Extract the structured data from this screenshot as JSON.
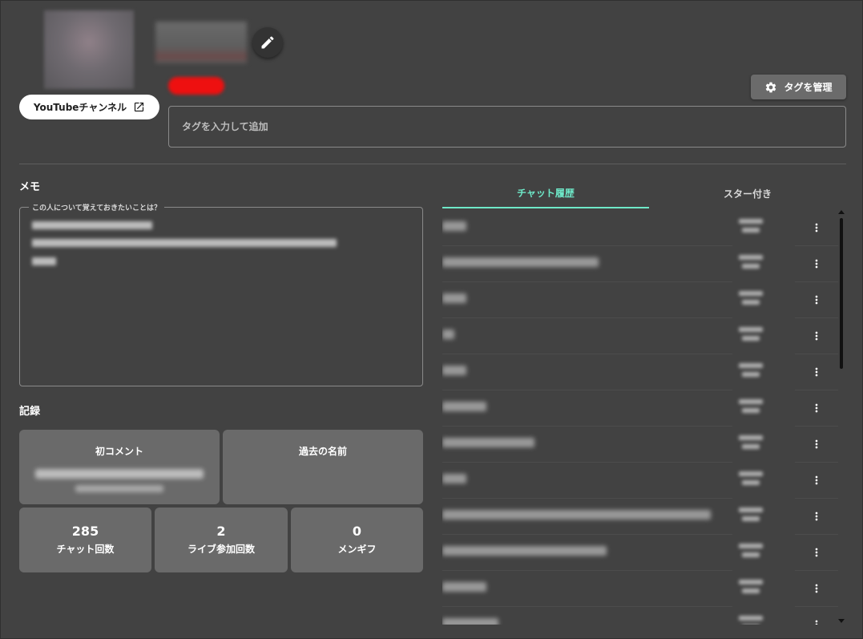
{
  "profile": {
    "youtube_button_label": "YouTubeチャンネル"
  },
  "tags": {
    "manage_button_label": "タグを管理",
    "input_placeholder": "タグを入力して追加"
  },
  "memo": {
    "title": "メモ",
    "field_label": "この人について覚えておきたいことは？"
  },
  "records": {
    "title": "記録",
    "first_comment_label": "初コメント",
    "past_names_label": "過去の名前",
    "stats": [
      {
        "value": "285",
        "label": "チャット回数"
      },
      {
        "value": "2",
        "label": "ライブ参加回数"
      },
      {
        "value": "0",
        "label": "メンギフ"
      }
    ]
  },
  "tabs": {
    "chat_history": "チャット履歴",
    "starred": "スター付き"
  },
  "colors": {
    "background": "#424242",
    "card": "#6a6a6a",
    "accent": "#6ee8c8",
    "badge": "#ee1010"
  },
  "icons": [
    "pencil-icon",
    "external-link-icon",
    "gear-icon",
    "more-vert-icon"
  ]
}
